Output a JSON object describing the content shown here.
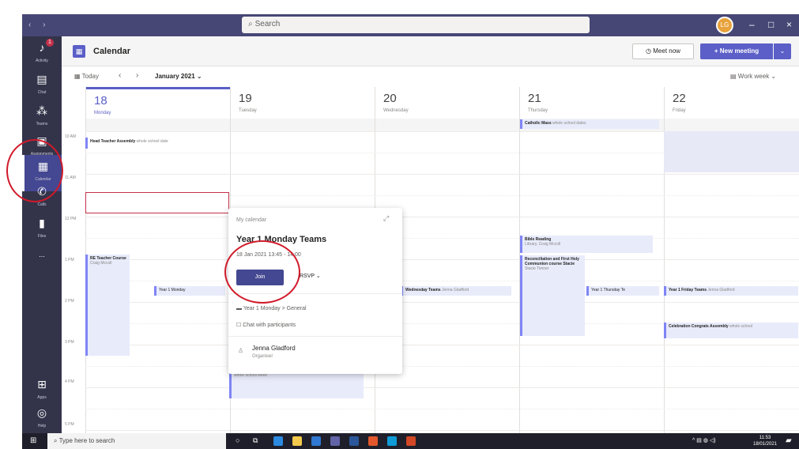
{
  "titlebar": {
    "search_placeholder": "Search",
    "avatar_initials": "LG"
  },
  "rail": [
    {
      "label": "Activity",
      "icon": "bell-icon"
    },
    {
      "label": "Chat",
      "icon": "chat-icon"
    },
    {
      "label": "Teams",
      "icon": "teams-icon"
    },
    {
      "label": "Assignments",
      "icon": "assignments-icon"
    },
    {
      "label": "Calendar",
      "icon": "calendar-icon"
    },
    {
      "label": "Calls",
      "icon": "phone-icon"
    },
    {
      "label": "Files",
      "icon": "files-icon"
    },
    {
      "label": "...",
      "icon": "more-icon"
    },
    {
      "label": "Apps",
      "icon": "apps-icon"
    },
    {
      "label": "Help",
      "icon": "help-icon"
    }
  ],
  "activity_badge": "1",
  "header": {
    "title": "Calendar",
    "meet_now": "Meet now",
    "new_meeting": "+ New meeting"
  },
  "toolbar": {
    "today": "Today",
    "month": "January 2021",
    "view": "Work week"
  },
  "days": [
    {
      "num": "18",
      "name": "Monday"
    },
    {
      "num": "19",
      "name": "Tuesday"
    },
    {
      "num": "20",
      "name": "Wednesday"
    },
    {
      "num": "21",
      "name": "Thursday"
    },
    {
      "num": "22",
      "name": "Friday"
    }
  ],
  "times": [
    "10 AM",
    "11 AM",
    "12 PM",
    "1 PM",
    "2 PM",
    "3 PM",
    "4 PM",
    "5 PM"
  ],
  "events": {
    "head_teacher": {
      "title": "Head Teacher Assembly",
      "sub": "whole school date"
    },
    "catholic_mass": {
      "title": "Catholic Mass",
      "sub": "whole school dates"
    },
    "re_teacher": {
      "title": "RE Teacher Course",
      "sub": "Craig Mccoll"
    },
    "year1_monday": {
      "title": "Year 1 Monday"
    },
    "bible_reading": {
      "title": "Bible Reading",
      "sub": "Library, Craig Mccoll"
    },
    "reconciliation": {
      "title": "Reconciliation and First Holy Communion course Stacie",
      "sub": "Stacie Tonner"
    },
    "year1_wed": {
      "title": "Wednesday Teams",
      "sub": "Jenna Gladford"
    },
    "year1_thu": {
      "title": "Year 1 Thursday Te"
    },
    "year1_fri": {
      "title": "Year 1 Friday Teams",
      "sub": "Jenna Gladford"
    },
    "celebration": {
      "title": "Celebration Congrats Assembly",
      "sub": "whole school"
    },
    "tue_bottom": {
      "title": "whole school week"
    }
  },
  "popup": {
    "calendar": "My calendar",
    "title": "Year 1 Monday Teams",
    "time": "18 Jan 2021 13:45 - 14:00",
    "join": "Join",
    "rsvp": "RSVP",
    "channel": "Year 1 Monday > General",
    "chat": "Chat with participants",
    "organizer": "Jenna Gladford",
    "organizer_role": "Organiser"
  },
  "taskbar": {
    "search": "Type here to search",
    "time": "11:53",
    "date": "18/01/2021"
  }
}
